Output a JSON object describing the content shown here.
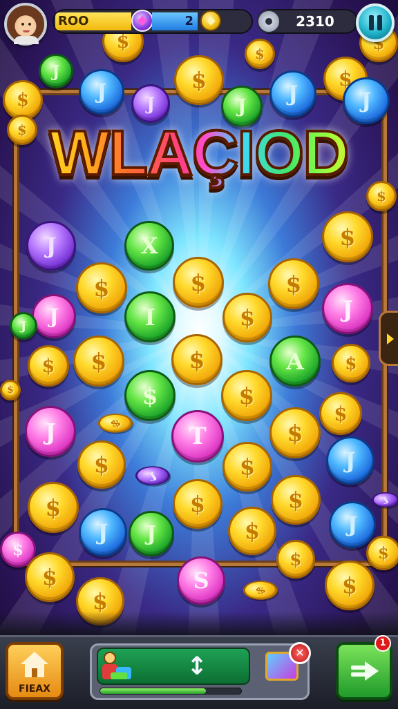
{
  "topbar": {
    "gold_value": "ROO",
    "blue_value": "2",
    "score": "2310"
  },
  "title": "WLAÇIOD",
  "bottombar": {
    "home_label": "FIEAX",
    "center_arrow_symbol": "↕",
    "progress": 0.75,
    "close_badge_symbol": "✕",
    "notification_count": "1"
  },
  "colors": {
    "gold": "#f2b90c",
    "blue": "#1f7ce0",
    "green": "#20a82b",
    "purple": "#7a36d8",
    "pink": "#e03ac5",
    "frame": "#b8783a"
  },
  "coins": [
    {
      "color": "green",
      "symbol": "J"
    },
    {
      "color": "blue",
      "symbol": "J"
    },
    {
      "color": "purple",
      "symbol": "J"
    },
    {
      "color": "gold",
      "symbol": "$"
    },
    {
      "color": "green",
      "symbol": "J"
    },
    {
      "color": "blue",
      "symbol": "J"
    },
    {
      "color": "gold",
      "symbol": "$"
    },
    {
      "color": "gold",
      "symbol": "$"
    },
    {
      "color": "gold",
      "symbol": "$"
    },
    {
      "color": "gold",
      "symbol": "$"
    },
    {
      "color": "blue",
      "symbol": "J"
    },
    {
      "color": "green",
      "symbol": "X"
    },
    {
      "color": "purple",
      "symbol": "J"
    },
    {
      "color": "gold",
      "symbol": "$"
    },
    {
      "color": "gold",
      "symbol": "$"
    },
    {
      "color": "gold",
      "symbol": "$"
    },
    {
      "color": "gold",
      "symbol": "$"
    },
    {
      "color": "gold",
      "symbol": "$"
    },
    {
      "color": "pink",
      "symbol": "J"
    },
    {
      "color": "green",
      "symbol": "I"
    },
    {
      "color": "gold",
      "symbol": "$"
    },
    {
      "color": "pink",
      "symbol": "J"
    },
    {
      "color": "gold",
      "symbol": "$"
    },
    {
      "color": "gold",
      "symbol": "$"
    },
    {
      "color": "gold",
      "symbol": "$"
    },
    {
      "color": "green",
      "symbol": "A"
    },
    {
      "color": "gold",
      "symbol": "$"
    },
    {
      "color": "gold",
      "symbol": "$"
    },
    {
      "color": "green",
      "symbol": "$"
    },
    {
      "color": "gold",
      "symbol": "$"
    },
    {
      "color": "pink",
      "symbol": "J"
    },
    {
      "color": "pink",
      "symbol": "T"
    },
    {
      "color": "gold",
      "symbol": "$"
    },
    {
      "color": "blue",
      "symbol": "J"
    },
    {
      "color": "gold",
      "symbol": "$"
    },
    {
      "color": "gold",
      "symbol": "$"
    },
    {
      "color": "gold",
      "symbol": "$"
    },
    {
      "color": "gold",
      "symbol": "$"
    },
    {
      "color": "gold",
      "symbol": "$"
    },
    {
      "color": "blue",
      "symbol": "J"
    },
    {
      "color": "green",
      "symbol": "J"
    },
    {
      "color": "gold",
      "symbol": "$"
    },
    {
      "color": "blue",
      "symbol": "J"
    },
    {
      "color": "pink",
      "symbol": "$"
    },
    {
      "color": "gold",
      "symbol": "$"
    },
    {
      "color": "gold",
      "symbol": "$"
    },
    {
      "color": "gold",
      "symbol": "$"
    },
    {
      "color": "pink",
      "symbol": "S"
    },
    {
      "color": "gold",
      "symbol": "$"
    },
    {
      "color": "gold",
      "symbol": "$"
    },
    {
      "color": "gold",
      "symbol": "$"
    },
    {
      "color": "gold",
      "symbol": "$"
    },
    {
      "color": "gold",
      "symbol": "$"
    },
    {
      "color": "gold",
      "symbol": "$"
    },
    {
      "color": "green",
      "symbol": "J"
    },
    {
      "color": "purple",
      "symbol": "J"
    },
    {
      "color": "purple",
      "symbol": "J"
    },
    {
      "color": "gold",
      "symbol": "$"
    }
  ]
}
